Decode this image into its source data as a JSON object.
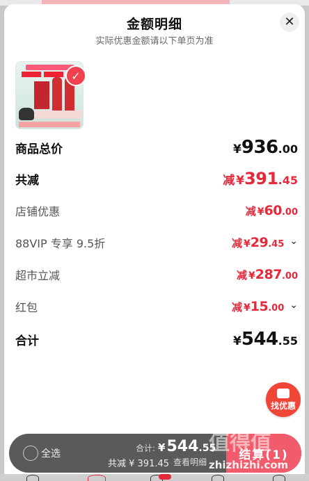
{
  "header": {
    "title": "金额明细",
    "subtitle": "实际优惠金额请以下单页为准",
    "close_icon": "close-icon"
  },
  "product": {
    "thumbnail_icon": "product-thumbnail",
    "selected_icon": "check-icon"
  },
  "rows": {
    "subtotal": {
      "label": "商品总价",
      "yen": "¥",
      "int": "936",
      "dec": ".00"
    },
    "total_discount": {
      "label": "共减",
      "minus": "减",
      "yen": "¥",
      "int": "391",
      "dec": ".45"
    },
    "store": {
      "label": "店铺优惠",
      "minus": "减",
      "yen": "¥",
      "int": "60",
      "dec": ".00"
    },
    "vip": {
      "label": "88VIP 专享 9.5折",
      "minus": "减",
      "yen": "¥",
      "int": "29",
      "dec": ".45",
      "chevron": "⌄"
    },
    "supermarket": {
      "label": "超市立减",
      "minus": "减",
      "yen": "¥",
      "int": "287",
      "dec": ".00"
    },
    "redpacket": {
      "label": "红包",
      "minus": "减",
      "yen": "¥",
      "int": "15",
      "dec": ".00",
      "chevron": "⌄"
    },
    "total": {
      "label": "合计",
      "yen": "¥",
      "int": "544",
      "dec": ".55"
    }
  },
  "floating": {
    "label": "找优惠"
  },
  "bottom_bar": {
    "select_all": "全选",
    "total_label": "合计:",
    "total_yen": "¥",
    "total_int": "544",
    "total_dec": ".55",
    "discount_text": "共减 ¥ 391.45",
    "details_link": "查看明细",
    "checkout": "结算(1)"
  },
  "watermark": {
    "text": "值得值",
    "url": "zhizhizhi.com"
  },
  "colors": {
    "accent_red": "#e5283a",
    "checkout_pink": "#f25b6c"
  }
}
